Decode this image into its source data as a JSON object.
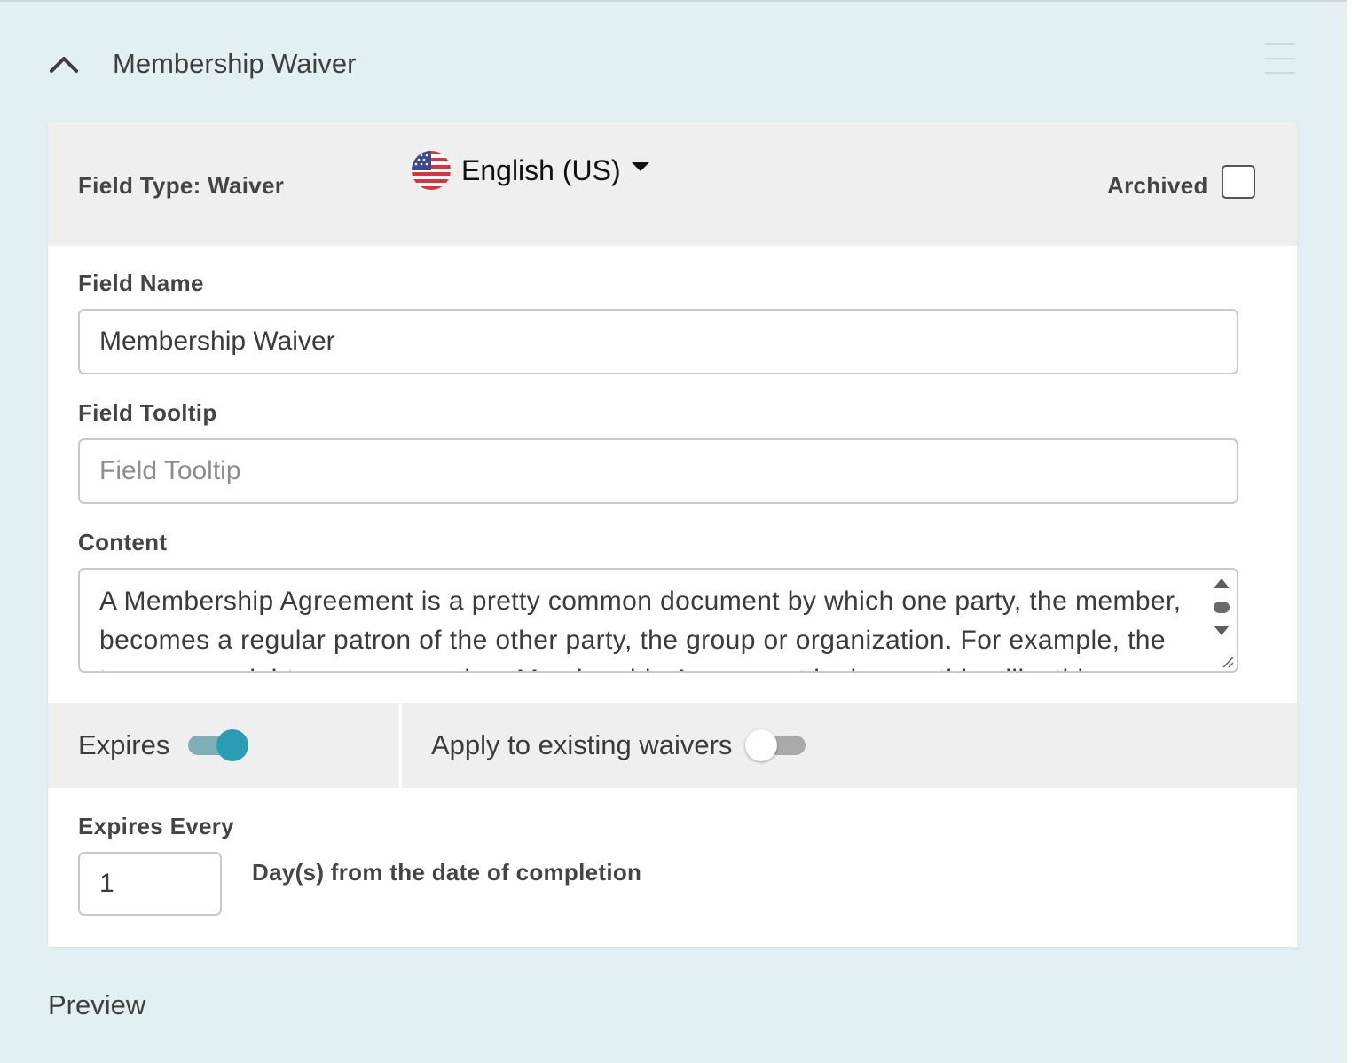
{
  "section": {
    "title": "Membership Waiver",
    "collapse_icon": "chevron-up-icon",
    "menu_icon": "hamburger-menu-icon"
  },
  "card_header": {
    "field_type": "Field Type: Waiver",
    "language": {
      "flag_icon": "us-flag-icon",
      "label": "English (US)"
    },
    "archived_label": "Archived",
    "archived_checked": false
  },
  "form": {
    "field_name_label": "Field Name",
    "field_name_value": "Membership Waiver",
    "field_tooltip_label": "Field Tooltip",
    "field_tooltip_placeholder": "Field Tooltip",
    "content_label": "Content",
    "content_text": "A Membership Agreement is a pretty common document by which one party, the member, becomes a regular patron of the other party, the group or organization. For example, the terms you might come across in a Membership Agreement look something like this."
  },
  "toggles": {
    "expires_label": "Expires",
    "expires_on": true,
    "apply_existing_label": "Apply to existing waivers",
    "apply_existing_on": false
  },
  "expiry": {
    "label": "Expires Every",
    "value": "1",
    "suffix": "Day(s) from the date of completion"
  },
  "preview": {
    "title": "Preview"
  },
  "colors": {
    "page_bg": "#e2eff3",
    "toggle_on": "#2a9db5",
    "panel_grey": "#efefef"
  }
}
